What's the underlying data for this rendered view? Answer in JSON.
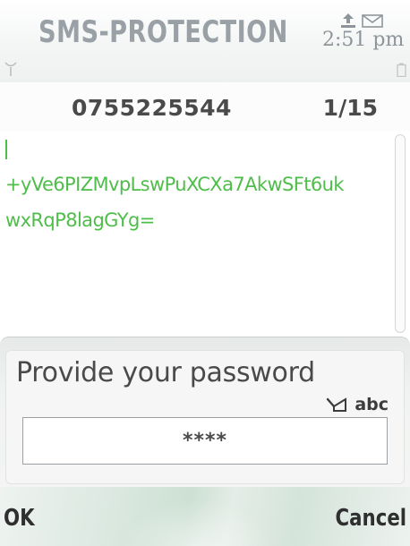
{
  "status_bar": {
    "app_title": "SMS-PROTECTION",
    "time": "2:51 pm",
    "icons": [
      "upload-icon",
      "mail-icon",
      "signal-icon",
      "battery-icon"
    ]
  },
  "message": {
    "sender": "0755225544",
    "counter": "1/15",
    "lines": [
      "+yVe6PIZMvpLswPuXCXa7AkwSFt6uk",
      "wxRqP8lagGYg="
    ]
  },
  "dialog": {
    "title": "Provide your password",
    "input_mode": "abc",
    "password_value": "****"
  },
  "softkeys": {
    "left": "OK",
    "right": "Cancel"
  },
  "colors": {
    "message_text": "#4fbd4a",
    "title_gray": "#9aa1a6",
    "softkey_green": "#cde0d4"
  }
}
